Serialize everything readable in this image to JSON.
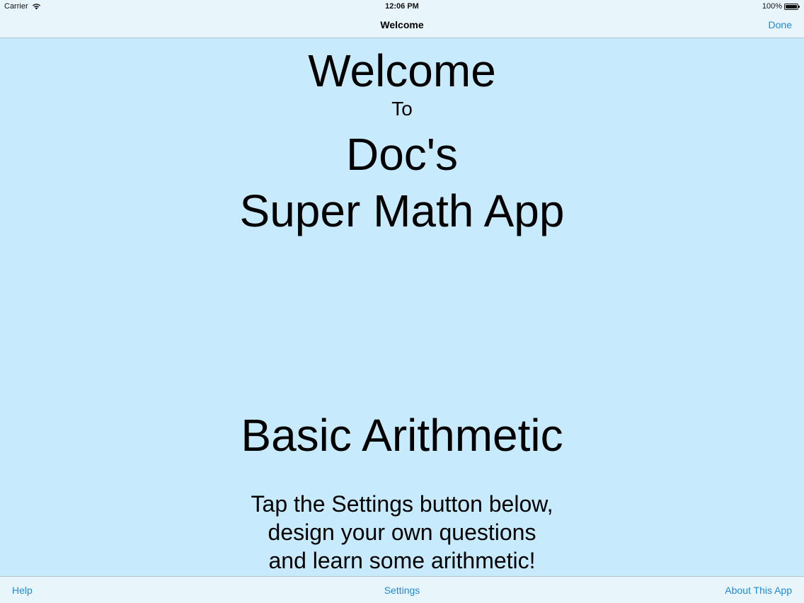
{
  "status_bar": {
    "carrier": "Carrier",
    "wifi_icon": "wifi-icon",
    "time": "12:06 PM",
    "battery_percent": "100%",
    "battery_icon": "battery-icon",
    "battery_level": 1.0
  },
  "nav_bar": {
    "title": "Welcome",
    "done_label": "Done"
  },
  "content": {
    "welcome": "Welcome",
    "to": "To",
    "app_name_line1": "Doc's",
    "app_name_line2": "Super Math App",
    "subject": "Basic Arithmetic",
    "instructions": [
      "Tap the Settings button below,",
      "design your own questions",
      "and learn some arithmetic!"
    ]
  },
  "toolbar": {
    "help_label": "Help",
    "settings_label": "Settings",
    "about_label": "About This App"
  },
  "colors": {
    "background": "#c7eafc",
    "bar_background": "#e8f5fb",
    "accent": "#1e8ad6",
    "text": "#000000"
  }
}
